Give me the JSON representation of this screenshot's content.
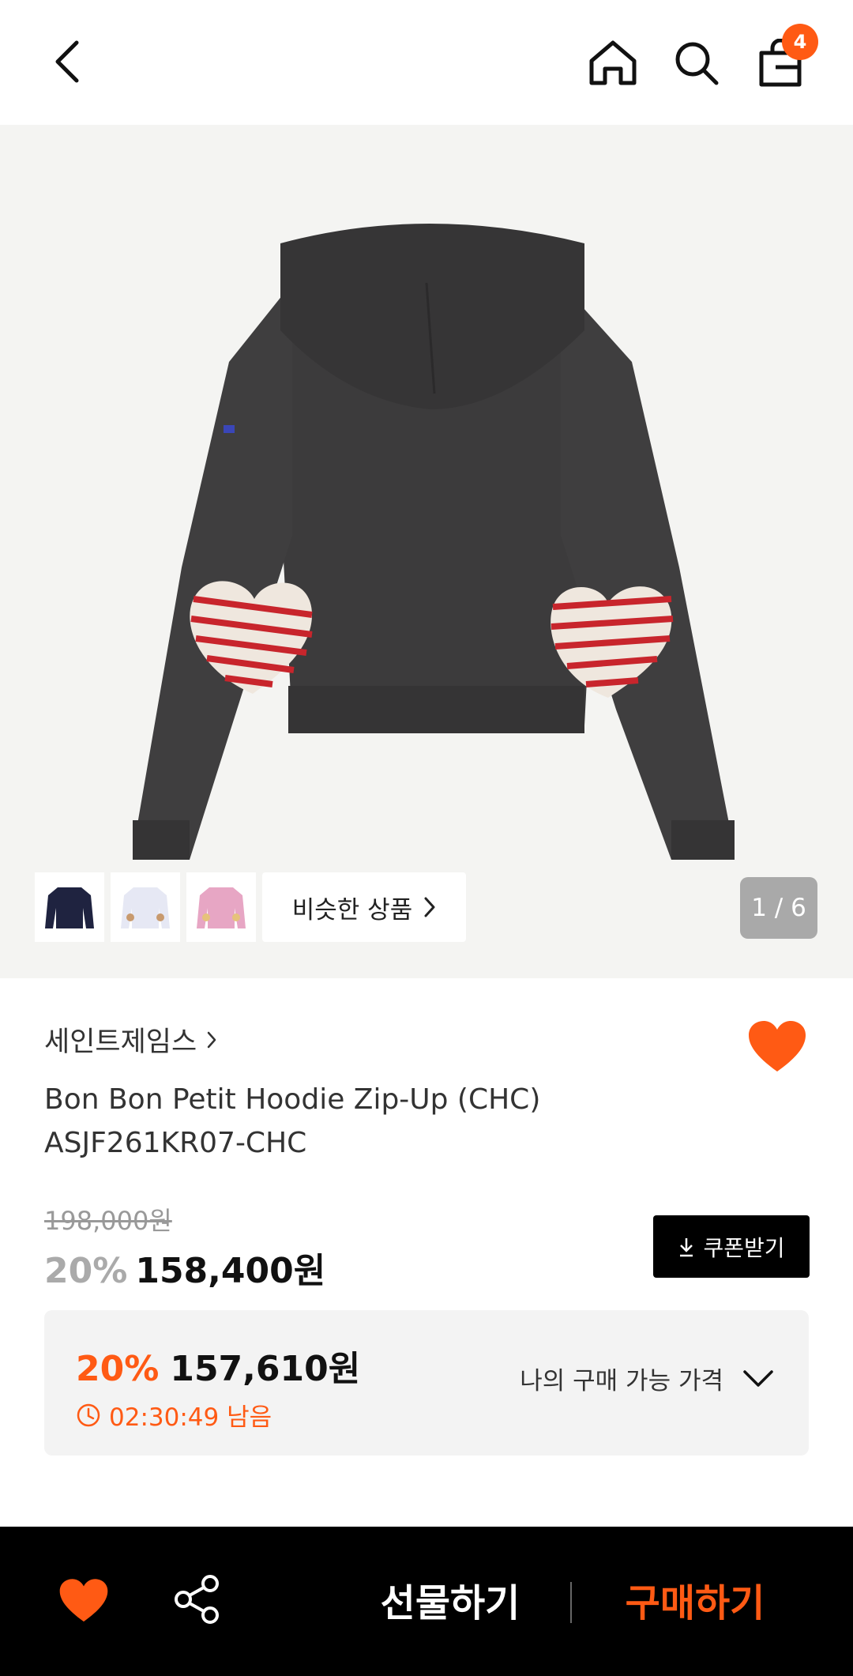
{
  "header": {
    "cart_count": "4",
    "icons": [
      "back-icon",
      "home-icon",
      "search-icon",
      "shopping-bag-icon"
    ]
  },
  "gallery": {
    "similar_label": "비슷한 상품",
    "pager": "1 / 6",
    "thumbnail_colors": [
      "#1f2340",
      "#e6e8f4",
      "#e7a6c4"
    ]
  },
  "product": {
    "brand": "세인트제임스",
    "name_line1": "Bon Bon Petit Hoodie Zip-Up (CHC)",
    "name_line2": "ASJF261KR07-CHC",
    "original_price": "198,000원",
    "discount": "20%",
    "sale_price": "158,400원",
    "coupon_label": "쿠폰받기"
  },
  "benefit": {
    "discount": "20%",
    "price": "157,610원",
    "timer": "02:30:49 남음",
    "my_price_label": "나의 구매 가능 가격"
  },
  "bottom_bar": {
    "gift_label": "선물하기",
    "buy_label": "구매하기"
  },
  "colors": {
    "accent": "#ff5a14",
    "hoodie": "#3c3b3c",
    "heart_stripe": "#c8252c"
  }
}
